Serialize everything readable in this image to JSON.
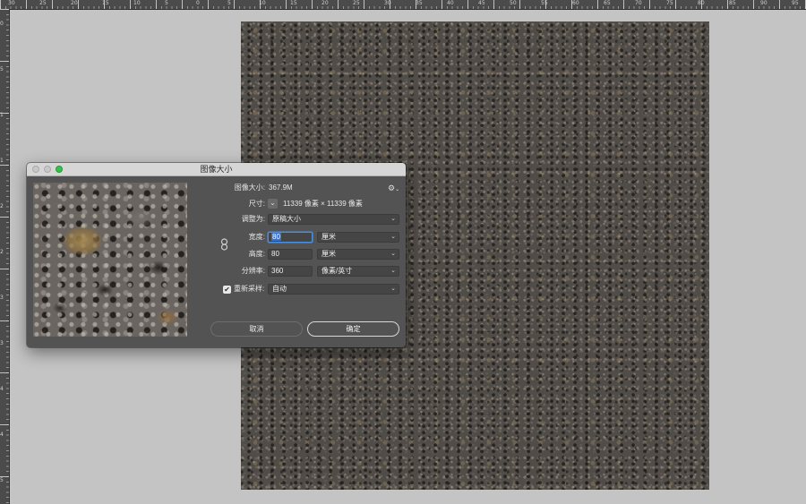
{
  "ruler": {
    "top_numbers": [
      "30",
      "25",
      "20",
      "15",
      "10",
      "5",
      "0",
      "5",
      "10",
      "15",
      "20",
      "25",
      "30",
      "35",
      "40",
      "45",
      "50",
      "55",
      "60",
      "65",
      "70",
      "75",
      "80",
      "85",
      "90",
      "95"
    ],
    "left_numbers": [
      "0",
      "5",
      "1",
      "1",
      "2",
      "2",
      "3",
      "3",
      "4",
      "4",
      "5"
    ]
  },
  "dialog": {
    "title": "图像大小",
    "image_size_label": "图像大小:",
    "image_size_value": "367.9M",
    "dimensions_label": "尺寸:",
    "dimensions_value": "11339 像素 × 11339 像素",
    "fit_to_label": "调整为:",
    "fit_to_value": "原稿大小",
    "width_label": "宽度:",
    "width_value": "80",
    "width_unit": "厘米",
    "height_label": "高度:",
    "height_value": "80",
    "height_unit": "厘米",
    "resolution_label": "分辨率:",
    "resolution_value": "360",
    "resolution_unit": "像素/英寸",
    "resample_label": "重新采样:",
    "resample_checked": true,
    "resample_value": "自动",
    "cancel_label": "取消",
    "ok_label": "确定"
  },
  "icons": {
    "gear": "gear-icon",
    "chevron": "chevron-down-icon",
    "link": "link-chain-icon",
    "check": "checkmark-icon"
  },
  "colors": {
    "focus": "#4a90e2",
    "zoom_button": "#35c24a"
  }
}
